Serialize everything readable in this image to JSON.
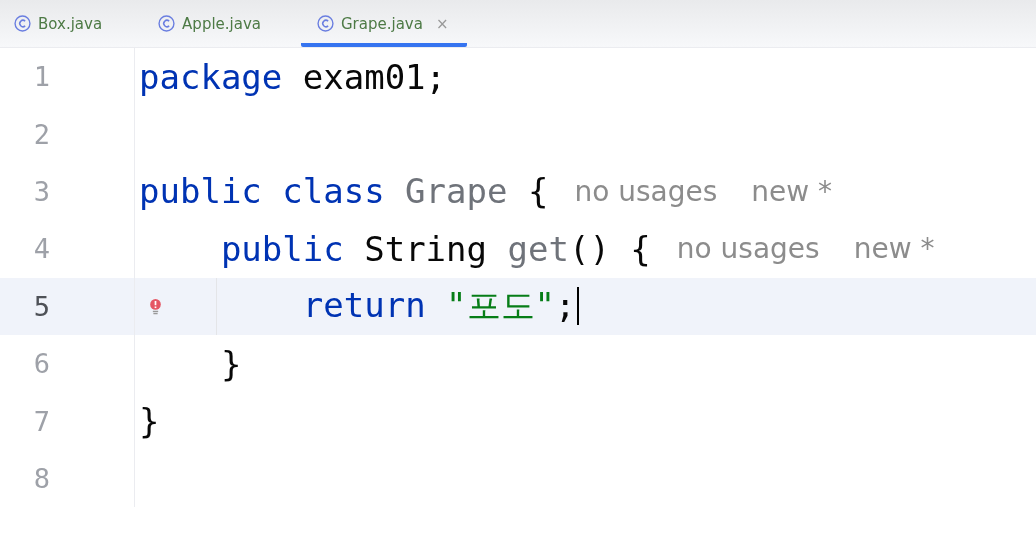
{
  "tabs": [
    {
      "label": "Box.java",
      "selected": false
    },
    {
      "label": "Apple.java",
      "selected": false
    },
    {
      "label": "Grape.java",
      "selected": true,
      "close": "×"
    }
  ],
  "lines": [
    {
      "number": "1",
      "current": false,
      "error": false,
      "tokens": [
        {
          "text": "package",
          "kind": "keyword"
        },
        {
          "text": " exam01;",
          "kind": "plain"
        }
      ]
    },
    {
      "number": "2",
      "current": false,
      "error": false
    },
    {
      "number": "3",
      "current": false,
      "error": false,
      "tokens": [
        {
          "text": "public class",
          "kind": "keyword"
        },
        {
          "text": " Grape",
          "kind": "unused"
        },
        {
          "text": " {",
          "kind": "plain"
        }
      ],
      "hints": [
        "no usages",
        "new *"
      ],
      "children": [
        {
          "number": "4",
          "current": false,
          "error": false,
          "tokens": [
            {
              "text": "public",
              "kind": "keyword"
            },
            {
              "text": " String ",
              "kind": "plain"
            },
            {
              "text": "get",
              "kind": "unused"
            },
            {
              "text": "() {",
              "kind": "plain"
            }
          ],
          "hints": [
            "no usages",
            "new *"
          ],
          "children": [
            {
              "number": "5",
              "current": true,
              "error": true,
              "tokens": [
                {
                  "text": "return",
                  "kind": "keyword"
                },
                {
                  "text": " \"포도\"",
                  "kind": "string"
                },
                {
                  "text": ";",
                  "kind": "plain"
                }
              ]
            }
          ]
        },
        {
          "number": "6",
          "current": false,
          "error": false,
          "tokens": [
            {
              "text": "}",
              "kind": "plain"
            }
          ]
        }
      ]
    },
    {
      "number": "7",
      "current": false,
      "error": false,
      "tokens": [
        {
          "text": "}",
          "kind": "plain"
        }
      ]
    },
    {
      "number": "8",
      "current": false,
      "error": false
    }
  ]
}
